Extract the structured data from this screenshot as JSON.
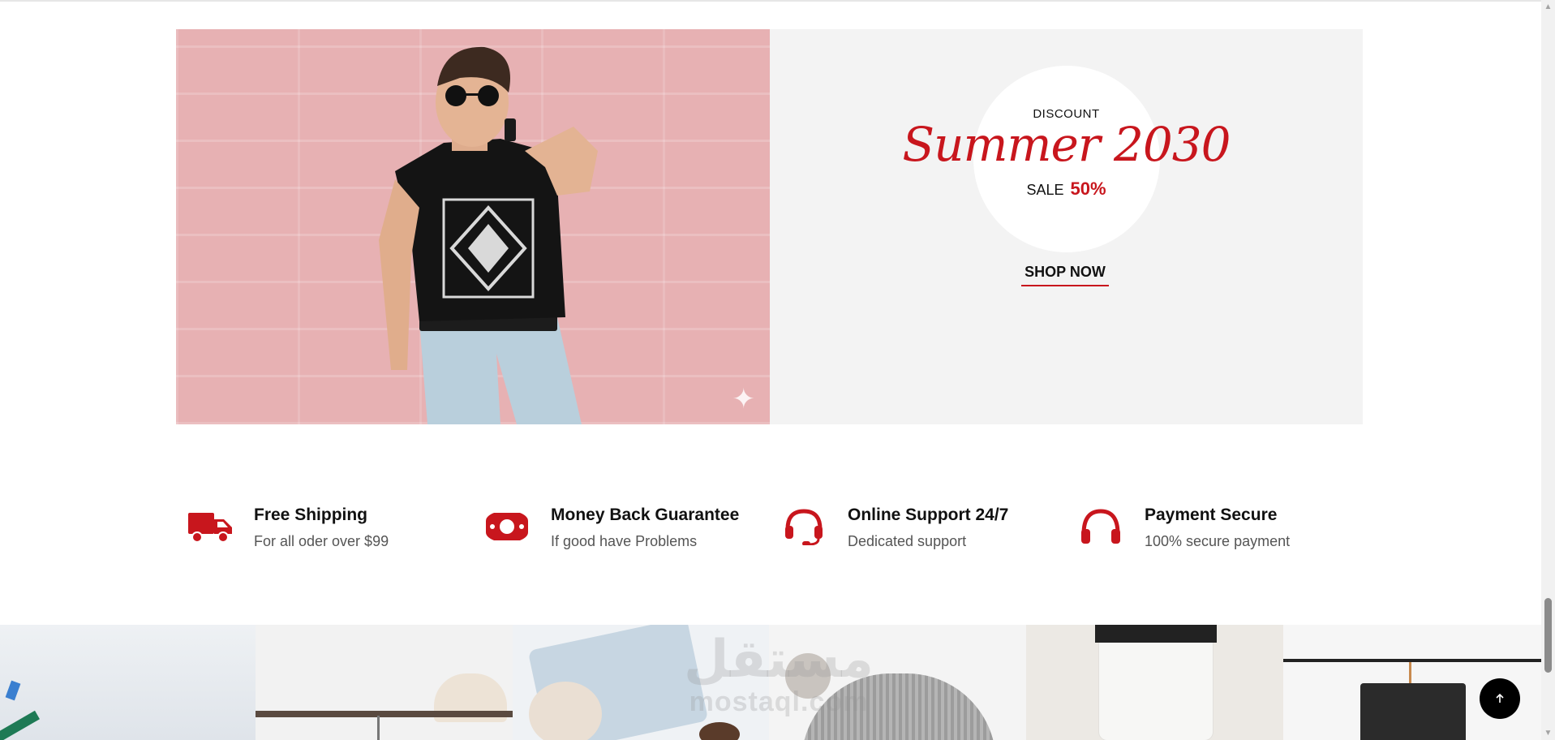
{
  "banner": {
    "discount_label": "DISCOUNT",
    "title": "Summer 2030",
    "sale_label": "SALE",
    "sale_percent": "50%",
    "cta_label": "SHOP NOW"
  },
  "features": [
    {
      "icon": "truck-icon",
      "title": "Free Shipping",
      "subtitle": "For all oder over $99"
    },
    {
      "icon": "money-icon",
      "title": "Money Back Guarantee",
      "subtitle": "If good have Problems"
    },
    {
      "icon": "headset-icon",
      "title": "Online Support 24/7",
      "subtitle": "Dedicated support"
    },
    {
      "icon": "headphones-icon",
      "title": "Payment Secure",
      "subtitle": "100% secure payment"
    }
  ],
  "watermark": {
    "arabic": "مستقل",
    "latin": "mostaql.com"
  },
  "colors": {
    "accent": "#c8161d",
    "promo_bg": "#f3f3f3",
    "photo_bg": "#e7b1b3"
  }
}
